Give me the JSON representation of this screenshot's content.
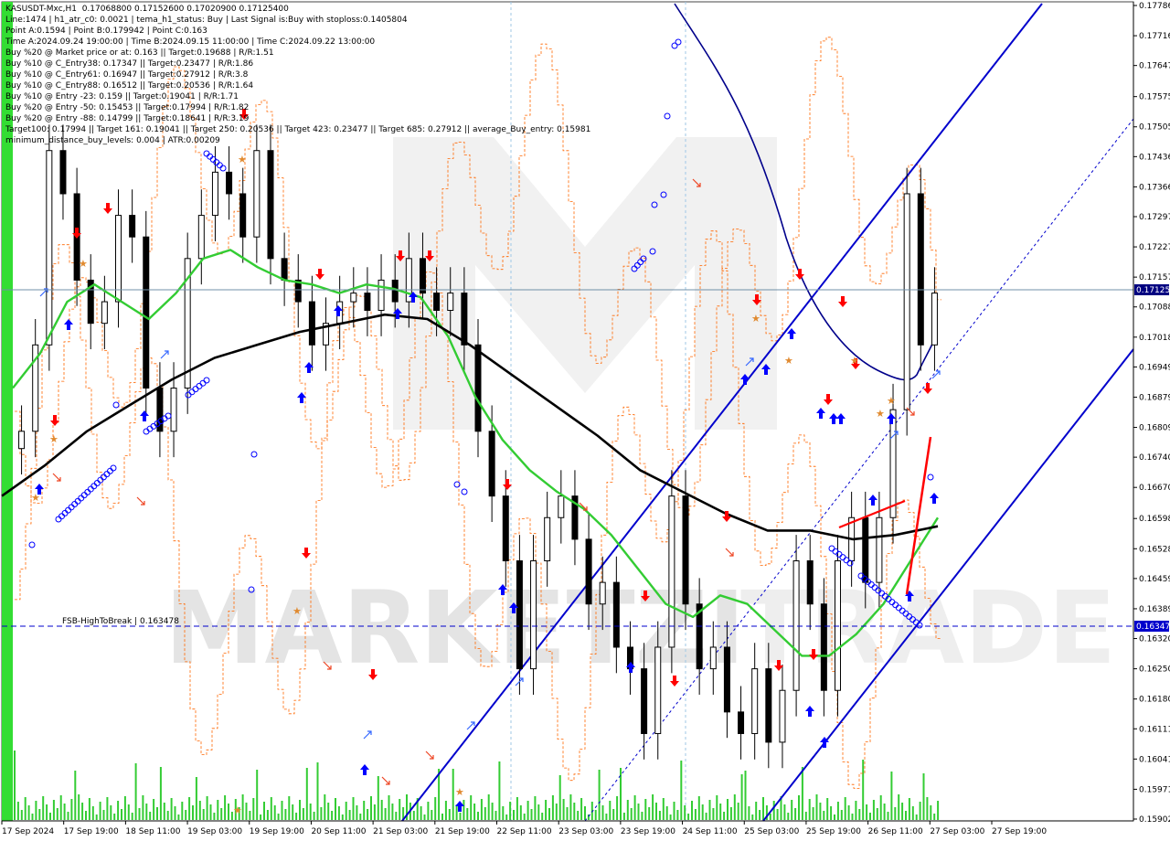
{
  "info_lines": [
    "KASUSDT-Mxc,H1  0.17068800 0.17152600 0.17020900 0.17125400",
    "Line:1474 | h1_atr_c0: 0.0021 | tema_h1_status: Buy | Last Signal is:Buy with stoploss:0.1405804",
    "Point A:0.1594 | Point B:0.179942 | Point C:0.163",
    "Time A:2024.09.24 19:00:00 | Time B:2024.09.15 11:00:00 | Time C:2024.09.22 13:00:00",
    "Buy %20 @ Market price or at: 0.163 || Target:0.19688 | R/R:1.51",
    "Buy %10 @ C_Entry38: 0.17347 || Target:0.23477 | R/R:1.86",
    "Buy %10 @ C_Entry61: 0.16947 || Target:0.27912 | R/R:3.8",
    "Buy %10 @ C_Entry88: 0.16512 || Target:0.20536 | R/R:1.64",
    "Buy %10 @ Entry -23: 0.159 || Target:0.19041 | R/R:1.71",
    "Buy %20 @ Entry -50: 0.15453 || Target:0.17994 | R/R:1.82",
    "Buy %20 @ Entry -88: 0.14799 || Target:0.18641 | R/R:3.19",
    "Target100: 0.17994 || Target 161: 0.19041 || Target 250: 0.20536 || Target 423: 0.23477 || Target 685: 0.27912 || average_Buy_entry: 0.15981",
    "minimum_distance_buy_levels: 0.004 | ATR:0.00209"
  ],
  "watermark": {
    "text_a": "MARKETZI",
    "text_b": "TRADE"
  },
  "colors": {
    "candle": "#000000",
    "ma_fast": "#33cc33",
    "ma_slow": "#000000",
    "channel": "#0000cc",
    "envelope": "#ff6600",
    "arrow_up": "#0000ff",
    "arrow_down": "#ff0000",
    "volume": "#33cc33",
    "current_price_tag": "#000080",
    "hline_tag": "#0000cc"
  },
  "chart_data": {
    "type": "line",
    "symbol": "KASUSDT-Mxc",
    "timeframe": "H1",
    "ohlc_last": {
      "open": 0.170688,
      "high": 0.171526,
      "low": 0.170209,
      "close": 0.171254
    },
    "y_ticks": [
      "0.17786",
      "0.17716",
      "0.17647",
      "0.17575",
      "0.17505",
      "0.17436",
      "0.17366",
      "0.17297",
      "0.17227",
      "0.17157",
      "0.17088",
      "0.17018",
      "0.16949",
      "0.16879",
      "0.16809",
      "0.16740",
      "0.16670",
      "0.16598",
      "0.16528",
      "0.16459",
      "0.16389",
      "0.16320",
      "0.16250",
      "0.16180",
      "0.16111",
      "0.16041",
      "0.15971",
      "0.15902"
    ],
    "x_ticks": [
      "17 Sep 2024",
      "17 Sep 19:00",
      "18 Sep 11:00",
      "19 Sep 03:00",
      "19 Sep 19:00",
      "20 Sep 11:00",
      "21 Sep 03:00",
      "21 Sep 19:00",
      "22 Sep 11:00",
      "23 Sep 03:00",
      "23 Sep 19:00",
      "24 Sep 11:00",
      "25 Sep 03:00",
      "25 Sep 19:00",
      "26 Sep 11:00",
      "27 Sep 03:00",
      "27 Sep 19:00"
    ],
    "ylim": [
      0.15902,
      0.17786
    ],
    "current_price": {
      "label": "0.17125",
      "value": 0.17125
    },
    "hline": {
      "name": "FSB-HighToBreak",
      "value": 0.163478,
      "label_text": "FSB-HighToBreak  |  0.163478",
      "tag": "0.16347"
    },
    "series": [
      {
        "kind": "close",
        "values": [
          0.168,
          0.17,
          0.1745,
          0.1735,
          0.1715,
          0.1705,
          0.171,
          0.173,
          0.1725,
          0.169,
          0.168,
          0.169,
          0.172,
          0.173,
          0.174,
          0.1735,
          0.1725,
          0.1745,
          0.172,
          0.1715,
          0.171,
          0.17,
          0.1705,
          0.171,
          0.1712,
          0.1708,
          0.1715,
          0.171,
          0.172,
          0.1712,
          0.1708,
          0.1712,
          0.17,
          0.168,
          0.1665,
          0.165,
          0.1625,
          0.165,
          0.166,
          0.1665,
          0.1655,
          0.164,
          0.1645,
          0.163,
          0.1625,
          0.161,
          0.163,
          0.1665,
          0.164,
          0.1625,
          0.163,
          0.1615,
          0.161,
          0.1625,
          0.1608,
          0.162,
          0.165,
          0.164,
          0.162,
          0.165,
          0.166,
          0.1645,
          0.166,
          0.1685,
          0.1735,
          0.17,
          0.1712
        ]
      },
      {
        "kind": "ma_fast",
        "values": [
          0.169,
          0.1698,
          0.171,
          0.1714,
          0.171,
          0.1706,
          0.1712,
          0.172,
          0.1722,
          0.1718,
          0.1715,
          0.1714,
          0.1712,
          0.1714,
          0.1713,
          0.1711,
          0.1702,
          0.1688,
          0.1678,
          0.1671,
          0.1666,
          0.1662,
          0.1656,
          0.1648,
          0.164,
          0.1637,
          0.1642,
          0.164,
          0.1634,
          0.1628,
          0.1628,
          0.1633,
          0.164,
          0.165,
          0.166
        ]
      },
      {
        "kind": "ma_slow",
        "values": [
          0.1665,
          0.1672,
          0.168,
          0.1686,
          0.1692,
          0.1697,
          0.17,
          0.1703,
          0.1705,
          0.1707,
          0.1706,
          0.17,
          0.1693,
          0.1686,
          0.1679,
          0.1671,
          0.1666,
          0.1661,
          0.1657,
          0.1657,
          0.1655,
          0.1656,
          0.1658
        ]
      }
    ]
  }
}
